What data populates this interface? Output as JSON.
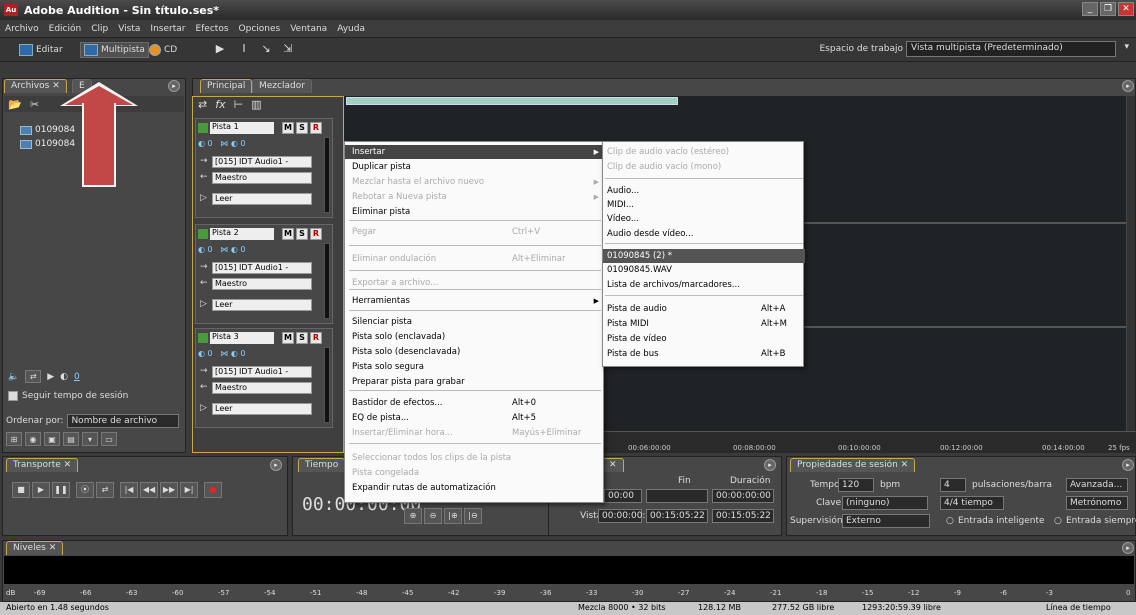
{
  "title": "Adobe Audition - Sin título.ses*",
  "app_icon": "Au",
  "menu": [
    "Archivo",
    "Edición",
    "Clip",
    "Vista",
    "Insertar",
    "Efectos",
    "Opciones",
    "Ventana",
    "Ayuda"
  ],
  "toolbar": {
    "editar": "Editar",
    "multipista": "Multipista",
    "cd": "CD"
  },
  "workspace": {
    "label": "Espacio de trabajo",
    "value": "Vista multipista (Predeterminado)"
  },
  "files_panel": {
    "tab": "Archivos",
    "tab2": "E",
    "files": [
      "0109084",
      "0109084"
    ],
    "follow_tempo": "Seguir tempo de sesión",
    "sort_label": "Ordenar por:",
    "sort_value": "Nombre de archivo",
    "vol_value": "0"
  },
  "main_tabs": {
    "principal": "Principal",
    "mezclador": "Mezclador"
  },
  "tracks": [
    {
      "name": "Pista 1",
      "vol": "0",
      "pan": "0",
      "input": "[015] IDT Audio1 -",
      "output": "Maestro",
      "mode": "Leer"
    },
    {
      "name": "Pista 2",
      "vol": "0",
      "pan": "0",
      "input": "[015] IDT Audio1 -",
      "output": "Maestro",
      "mode": "Leer"
    },
    {
      "name": "Pista 3",
      "vol": "0",
      "pan": "0",
      "input": "[015] IDT Audio1 -",
      "output": "Maestro",
      "mode": "Leer"
    }
  ],
  "msr": {
    "m": "M",
    "s": "S",
    "r": "R"
  },
  "context_menu": [
    {
      "label": "Insertar",
      "shortcut": "",
      "submenu": true,
      "state": "highlight"
    },
    {
      "label": "Duplicar pista",
      "shortcut": "",
      "submenu": false,
      "state": "normal"
    },
    {
      "label": "Mezclar hasta el archivo nuevo",
      "shortcut": "",
      "submenu": true,
      "state": "disabled"
    },
    {
      "label": "Rebotar a Nueva pista",
      "shortcut": "",
      "submenu": true,
      "state": "disabled"
    },
    {
      "label": "Eliminar pista",
      "shortcut": "",
      "submenu": false,
      "state": "normal"
    },
    {
      "label": "Pegar",
      "shortcut": "Ctrl+V",
      "submenu": false,
      "state": "disabled"
    },
    {
      "label": "Eliminar ondulación",
      "shortcut": "Alt+Eliminar",
      "submenu": false,
      "state": "disabled"
    },
    {
      "label": "Exportar a archivo...",
      "shortcut": "",
      "submenu": false,
      "state": "disabled"
    },
    {
      "label": "Herramientas",
      "shortcut": "",
      "submenu": true,
      "state": "normal"
    },
    {
      "label": "Silenciar pista",
      "shortcut": "",
      "submenu": false,
      "state": "normal"
    },
    {
      "label": "Pista solo (enclavada)",
      "shortcut": "",
      "submenu": false,
      "state": "normal"
    },
    {
      "label": "Pista solo (desenclavada)",
      "shortcut": "",
      "submenu": false,
      "state": "normal"
    },
    {
      "label": "Pista solo segura",
      "shortcut": "",
      "submenu": false,
      "state": "normal"
    },
    {
      "label": "Preparar pista para grabar",
      "shortcut": "",
      "submenu": false,
      "state": "normal"
    },
    {
      "label": "Bastidor de efectos...",
      "shortcut": "Alt+0",
      "submenu": false,
      "state": "normal"
    },
    {
      "label": "EQ de pista...",
      "shortcut": "Alt+5",
      "submenu": false,
      "state": "normal"
    },
    {
      "label": "Insertar/Eliminar hora...",
      "shortcut": "Mayús+Eliminar",
      "submenu": false,
      "state": "disabled"
    },
    {
      "label": "Seleccionar todos los clips de la pista",
      "shortcut": "",
      "submenu": false,
      "state": "disabled"
    },
    {
      "label": "Pista congelada",
      "shortcut": "",
      "submenu": false,
      "state": "disabled"
    },
    {
      "label": "Expandir rutas de automatización",
      "shortcut": "",
      "submenu": false,
      "state": "normal"
    }
  ],
  "sub_menu": [
    {
      "label": "Clip de audio vacío (estéreo)",
      "shortcut": "",
      "state": "disabled"
    },
    {
      "label": "Clip de audio vacío (mono)",
      "shortcut": "",
      "state": "disabled"
    },
    {
      "label": "Audio...",
      "shortcut": "",
      "state": "normal"
    },
    {
      "label": "MIDI...",
      "shortcut": "",
      "state": "normal"
    },
    {
      "label": "Vídeo...",
      "shortcut": "",
      "state": "normal"
    },
    {
      "label": "Audio desde vídeo...",
      "shortcut": "",
      "state": "normal"
    },
    {
      "label": "01090845 (2) *",
      "shortcut": "",
      "state": "highlight"
    },
    {
      "label": "01090845.WAV",
      "shortcut": "",
      "state": "normal"
    },
    {
      "label": "Lista de archivos/marcadores...",
      "shortcut": "",
      "state": "normal"
    },
    {
      "label": "Pista de audio",
      "shortcut": "Alt+A",
      "state": "normal"
    },
    {
      "label": "Pista MIDI",
      "shortcut": "Alt+M",
      "state": "normal"
    },
    {
      "label": "Pista de vídeo",
      "shortcut": "",
      "state": "normal"
    },
    {
      "label": "Pista de bus",
      "shortcut": "Alt+B",
      "state": "normal"
    }
  ],
  "ruler": [
    "00:06:00:00",
    "00:08:00:00",
    "00:10:00:00",
    "00:12:00:00",
    "00:14:00:00",
    "25 fps"
  ],
  "transport": {
    "tab": "Transporte"
  },
  "time": {
    "tab": "Tiempo",
    "display": "00:00:00:00"
  },
  "selection": {
    "fin": "Fin",
    "duracion": "Duración",
    "sel_start": "00:00",
    "sel_end": "",
    "sel_dur": "00:00:00:00",
    "vista": "Vista",
    "view_start": "00:00:00:00",
    "view_end": "00:15:05:22",
    "view_dur": "00:15:05:22"
  },
  "props": {
    "tab": "Propiedades de sesión",
    "tempo_label": "Tempo:",
    "tempo": "120",
    "bpm": "bpm",
    "beats": "4",
    "beats_label": "pulsaciones/barra",
    "advanced": "Avanzada...",
    "clave_label": "Clave:",
    "clave": "(ninguno)",
    "time_sig": "4/4 tiempo",
    "metronome": "Metrónomo",
    "supervision_label": "Supervisión:",
    "supervision": "Externo",
    "smart_input": "Entrada inteligente",
    "always_input": "Entrada siempre"
  },
  "levels": {
    "tab": "Niveles",
    "scale": [
      "dB",
      "-69",
      "-66",
      "-63",
      "-60",
      "-57",
      "-54",
      "-51",
      "-48",
      "-45",
      "-42",
      "-39",
      "-36",
      "-33",
      "-30",
      "-27",
      "-24",
      "-21",
      "-18",
      "-15",
      "-12",
      "-9",
      "-6",
      "-3",
      "0"
    ]
  },
  "status": {
    "opened": "Abierto en 1.48 segundos",
    "mix": "Mezcla 8000 • 32 bits",
    "mem": "128.12 MB",
    "disk": "277.52 GB libre",
    "time_free": "1293:20:59.39 libre",
    "view": "Línea de tiempo"
  }
}
